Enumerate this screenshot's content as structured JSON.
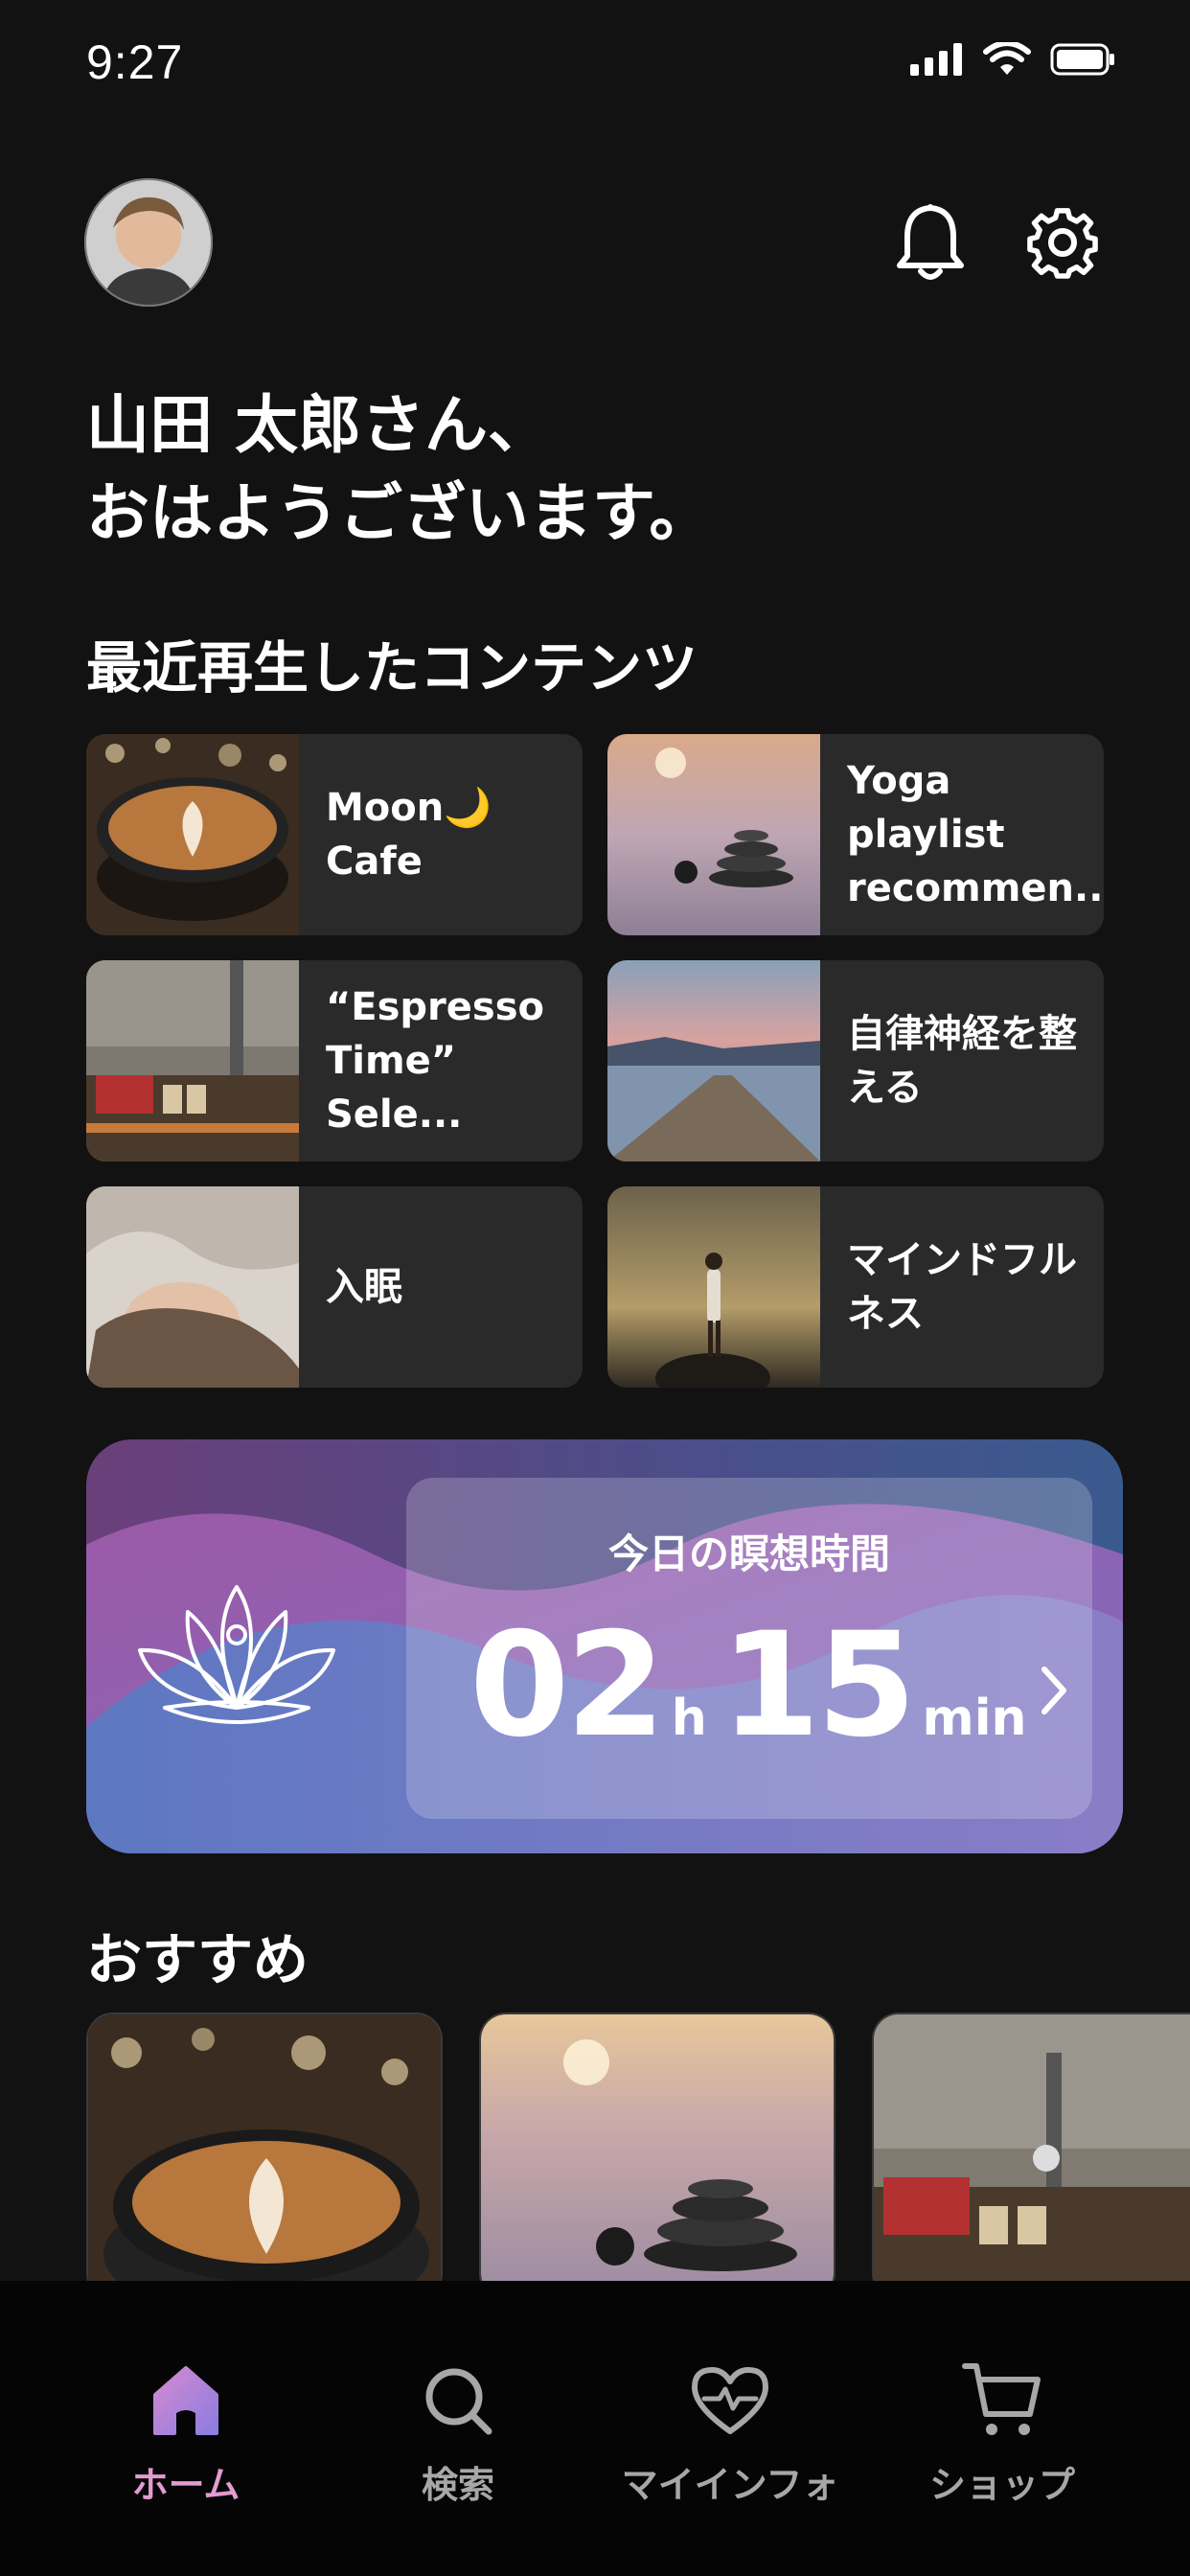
{
  "status_bar": {
    "time": "9:27"
  },
  "header": {
    "avatar_icon": "user-avatar",
    "bell_icon": "bell-icon",
    "settings_icon": "gear-icon"
  },
  "greeting": {
    "line1": "山田 太郎さん、",
    "line2": "おはようございます。"
  },
  "recent": {
    "title": "最近再生したコンテンツ",
    "items": [
      {
        "label": "Moon🌙Cafe",
        "thumb": "latte-art"
      },
      {
        "label": "Yoga playlist recommen...",
        "thumb": "stacked-stones-sunset"
      },
      {
        "label": "“Espresso Time” Sele...",
        "thumb": "cafe-interior"
      },
      {
        "label": "自律神経を整える",
        "thumb": "pier-lake"
      },
      {
        "label": "入眠",
        "thumb": "sleeping-woman"
      },
      {
        "label": "マインドフルネス",
        "thumb": "woman-on-rock"
      }
    ]
  },
  "meditation": {
    "title": "今日の瞑想時間",
    "hours": "02",
    "hours_unit": "h",
    "minutes": "15",
    "minutes_unit": "min",
    "icon": "lotus-icon"
  },
  "recommended": {
    "title": "おすすめ",
    "items": [
      {
        "thumb": "latte-art"
      },
      {
        "thumb": "stacked-stones-sunset"
      },
      {
        "thumb": "cafe-interior"
      }
    ]
  },
  "nav": {
    "items": [
      {
        "label": "ホーム",
        "icon": "home-icon",
        "active": true
      },
      {
        "label": "検索",
        "icon": "search-icon",
        "active": false
      },
      {
        "label": "マイインフォ",
        "icon": "heart-pulse-icon",
        "active": false
      },
      {
        "label": "ショップ",
        "icon": "cart-icon",
        "active": false
      }
    ]
  },
  "colors": {
    "background": "#121212",
    "card": "#2a2a2a",
    "nav_active": "#e39bd0",
    "nav_inactive": "#a7a7a7"
  }
}
